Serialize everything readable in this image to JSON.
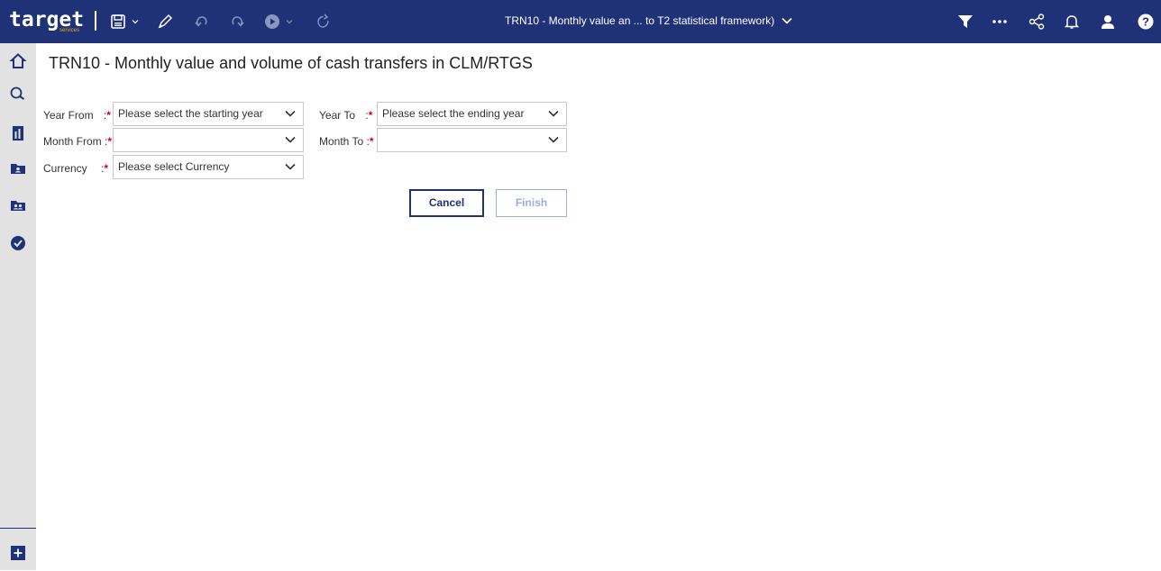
{
  "topbar": {
    "logo_text": "target",
    "logo_sub": "services",
    "report_title": "TRN10 - Monthly value an ... to T2 statistical framework)",
    "icons": [
      "save-icon",
      "chevron-down-icon",
      "edit-icon",
      "undo-icon",
      "redo-icon",
      "run-icon",
      "refresh-icon",
      "filter-icon",
      "more-icon",
      "share-icon",
      "bell-icon",
      "user-icon",
      "help-icon"
    ]
  },
  "sidebar": {
    "items": [
      "home-icon",
      "search-icon",
      "document-icon",
      "folder-user-icon",
      "folder-group-icon",
      "checkmark-icon",
      "add-icon"
    ]
  },
  "page": {
    "title": "TRN10 - Monthly value and volume of cash transfers in CLM/RTGS"
  },
  "form": {
    "year_from_label": "Year From",
    "year_from_colon": ":",
    "year_from_placeholder": "Please select the starting year",
    "year_to_label": "Year To",
    "year_to_colon": ":",
    "year_to_placeholder": "Please select the ending year",
    "month_from_label": "Month From :",
    "month_from_value": "",
    "month_to_label": "Month To :",
    "month_to_value": "",
    "currency_label": "Currency",
    "currency_colon": ":",
    "currency_placeholder": "Please select Currency",
    "required_mark": "*"
  },
  "buttons": {
    "cancel": "Cancel",
    "finish": "Finish"
  },
  "colors": {
    "topbar": "#1f3277",
    "sidebar": "#e2e2e2",
    "required": "#d0021b",
    "accent": "#1f3277",
    "disabled": "#9bb0d8"
  }
}
